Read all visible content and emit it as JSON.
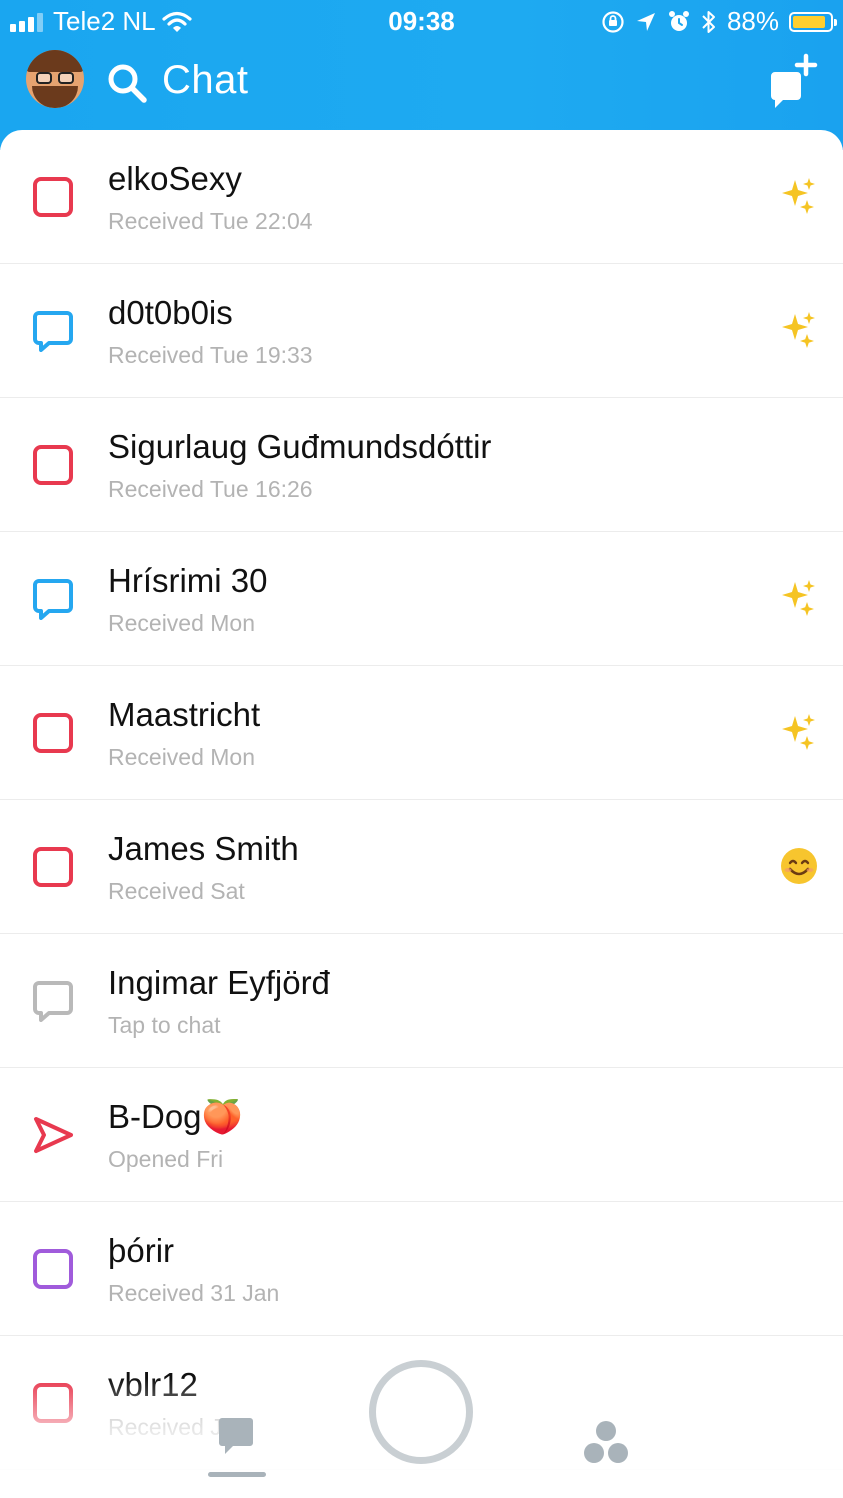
{
  "status_bar": {
    "carrier": "Tele2 NL",
    "time": "09:38",
    "battery_percent": "88%",
    "battery_level": 0.88,
    "icons": [
      "signal-bars-icon",
      "wifi-icon",
      "orientation-lock-icon",
      "location-arrow-icon",
      "alarm-clock-icon",
      "bluetooth-icon",
      "battery-icon"
    ]
  },
  "header": {
    "title": "Chat",
    "avatar": "bitmoji-avatar",
    "search_icon": "search-icon",
    "new_chat_icon": "new-chat-icon"
  },
  "colors": {
    "header_blue": "#1ea8f0",
    "red": "#e8394f",
    "blue": "#25a7f0",
    "purple": "#a05bdb",
    "gray": "#b9b9b9",
    "status_text": "#b3b3b3",
    "name_text": "#111111"
  },
  "chats": [
    {
      "name": "elkoSexy",
      "status": "Received Tue 22:04",
      "icon": "square-red",
      "emoji": "sparkles"
    },
    {
      "name": "d0t0b0is",
      "status": "Received Tue 19:33",
      "icon": "chat-bubble-blue",
      "emoji": "sparkles"
    },
    {
      "name": "Sigurlaug Guđmundsdóttir",
      "status": "Received Tue 16:26",
      "icon": "square-red",
      "emoji": ""
    },
    {
      "name": "Hrísrimi 30",
      "status": "Received Mon",
      "icon": "chat-bubble-blue",
      "emoji": "sparkles"
    },
    {
      "name": "Maastricht",
      "status": "Received Mon",
      "icon": "square-red",
      "emoji": "sparkles"
    },
    {
      "name": "James Smith",
      "status": "Received Sat",
      "icon": "square-red",
      "emoji": "smiling-face"
    },
    {
      "name": "Ingimar Eyfjörđ",
      "status": "Tap to chat",
      "icon": "chat-bubble-gray",
      "emoji": ""
    },
    {
      "name": "B-Dog🍑",
      "status": "Opened Fri",
      "icon": "send-arrow-red",
      "emoji": ""
    },
    {
      "name": "þórir",
      "status": "Received 31 Jan",
      "icon": "square-purple",
      "emoji": ""
    },
    {
      "name": "vblr12",
      "status": "Received Jan",
      "icon": "square-red",
      "emoji": ""
    }
  ],
  "bottom_nav": {
    "items": [
      "chat-nav-icon",
      "capture-button",
      "discover-icon"
    ]
  }
}
